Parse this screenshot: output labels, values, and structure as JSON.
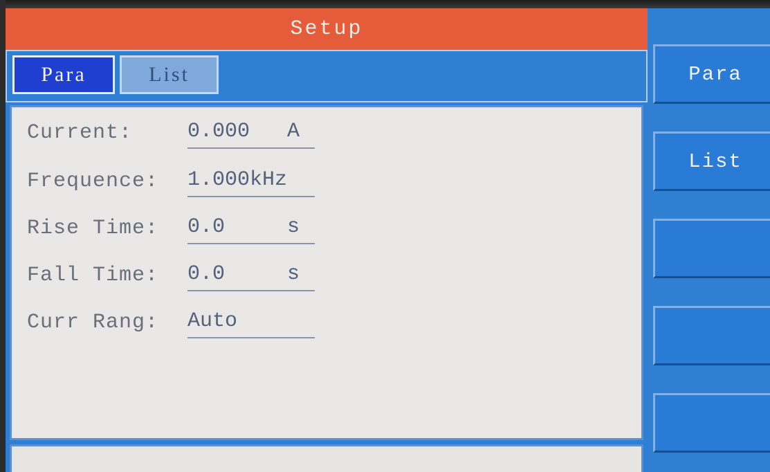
{
  "title": "Setup",
  "tabs": [
    {
      "label": "Para",
      "active": true
    },
    {
      "label": "List",
      "active": false
    }
  ],
  "params": [
    {
      "label": "Current:",
      "value": "0.000",
      "unit": "A"
    },
    {
      "label": "Frequence:",
      "value": "1.000kHz",
      "unit": ""
    },
    {
      "label": "Rise Time:",
      "value": "0.0",
      "unit": "s"
    },
    {
      "label": "Fall Time:",
      "value": "0.0",
      "unit": "s"
    },
    {
      "label": "Curr Rang:",
      "value": "Auto",
      "unit": ""
    }
  ],
  "softkeys": [
    {
      "label": "Para"
    },
    {
      "label": "List"
    },
    {
      "label": ""
    },
    {
      "label": ""
    },
    {
      "label": ""
    }
  ],
  "status": {
    "text": ""
  },
  "colors": {
    "title_bar": "#e45c3a",
    "background": "#2f7fd3",
    "active_tab": "#1e3fd0",
    "panel": "#e9e8e6"
  }
}
